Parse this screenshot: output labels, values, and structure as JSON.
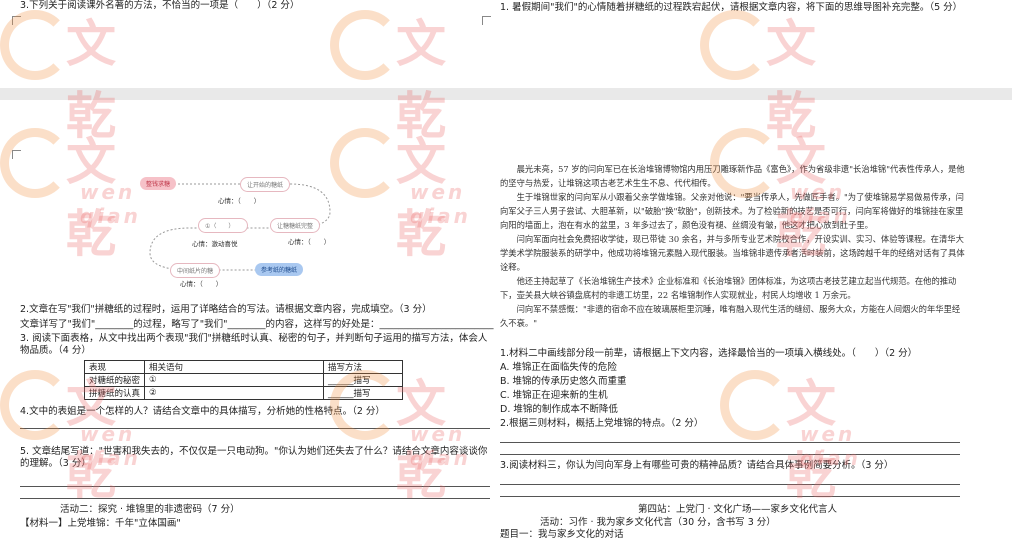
{
  "top": {
    "q3": "3.下列关于阅读课外名著的方法，不恰当的一项是（　　）（2 分）",
    "q1": "1. 暑假期间\"我们\"的心情随着拼糖纸的过程跌宕起伏，请根据文章内容，将下面的思维导图补充完整。（5 分）"
  },
  "diagram": {
    "start": "整钱求糖",
    "n1": "让开始的糖纸",
    "heart": "心情：（　　）",
    "n2_left": "①（　　）",
    "n3": "让糖糖纸完整",
    "heart2": "心情：（　　）",
    "heart3": "心情：激动喜悦",
    "n4": "中间纸片的糖",
    "end": "参考纸的糖纸",
    "heart4": "心情：（　　）"
  },
  "left": {
    "q2": "2.文章在写\"我们\"拼糖纸的过程时，运用了详略结合的写法。请根据文章内容，完成填空。（3 分）",
    "q2b": "文章详写了\"我们\"________的过程，略写了\"我们\"________的内容，这样写的好处是：________________________",
    "q3": "3. 阅读下面表格，从文中找出两个表现\"我们\"拼糖纸时认真、秘密的句子，并判断句子运用的描写方法，体会人物品质。（4 分）",
    "table": {
      "headers": [
        "表现",
        "相关语句",
        "描写方法"
      ],
      "rows": [
        [
          "对糖纸的秘密",
          "①",
          "______描写"
        ],
        [
          "拼糖纸的认真",
          "②",
          "______描写"
        ]
      ]
    },
    "q4": "4.文中的表姐是一个怎样的人？请结合文章中的具体描写，分析她的性格特点。（2 分）",
    "q5": "5. 文章结尾写道：\"世害和我失去的，不仅仅是一只电动狗。\"你认为她们还失去了什么？请结合文章内容谈谈你的理解。（3 分）",
    "activity": "活动二：探究 · 堆锦里的非遗密码（7 分）",
    "material": "【材料一】上党堆锦：千年\"立体国画\""
  },
  "right": {
    "para1": "晨光未亮，57 岁的闫向军已在长治堆锦博物馆内用压刀雕琢新作品《富色》，作为省级非遗\"长治堆锦\"代表性传承人，是他的坚守与热爱，让堆锦这项古老艺术生生不息、代代相传。",
    "para2": "生于堆锦世家的闫向军从小跟着父亲学做堆锦。父亲对他说：\"要当传承人，先做匠手者。\"为了使堆锦易学易做易传承，闫向军父子三人男子尝试、大胆革新，以\"破胎\"换\"软胎\"，创新技术。为了检验新的技艺是否可行，闫向军将做好的堆锦挂在家里向阳的墙面上，泡在有水的盆里，3 年多过去了，颜色没有褪、丝绸没有皱，他这才把心放到肚子里。",
    "para3": "闫向军面向社会免费招收学徒，现已带徒 30 余名，并与多所专业艺术院校合作，开设实训、实习、体验等课程。在清华大学美术学院服装系的研学中，他成功将堆锦元素融入现代服装。当堆锦非遗传承者活时装前，这场跨越千年的经络对话有了具体诠释。",
    "para4": "他还主持起草了《长治堆锦生产技术》企业标准和《长治堆锦》团体标准，为这项古老技艺建立起当代规范。在他的推动下，壶关县大峡谷镇盘底村的非遗工坊里，22 名堆锦制作人实现就业，村民人均增收 1 万余元。",
    "para5": "闫向军不禁感慨：\"非遗的宿命不应在玻璃展柜里沉睡，唯有融入现代生活的缝纫、服务大众，方能在人间烟火的年华里经久不衰。\"",
    "q1": "1.材料二中画线部分段一前辈，请根据上下文内容，选择最恰当的一项填入横线处。（　　）（2 分）",
    "optA": "A. 堆锦正在面临失传的危险",
    "optB": "B. 堆锦的传承历史悠久而重重",
    "optC": "C. 堆锦正在迎来新的生机",
    "optD": "D. 堆锦的制作成本不断降低",
    "q2": "2.根据三则材料，概括上党堆锦的特点。（2 分）",
    "q3": "3.阅读材料三，你认为闫向军身上有哪些可贵的精神品质？请结合具体事例简要分析。（3 分）",
    "station": "第四站：上党门 · 文化广场——家乡文化代言人",
    "activity": "活动：习作 · 我为家乡文化代言（30 分，含书写 3 分）",
    "topic": "题目一：我与家乡文化的对话"
  },
  "watermark": {
    "brand": "文乾",
    "pinyin": "wen qian",
    "color": "#ec6e6e"
  }
}
